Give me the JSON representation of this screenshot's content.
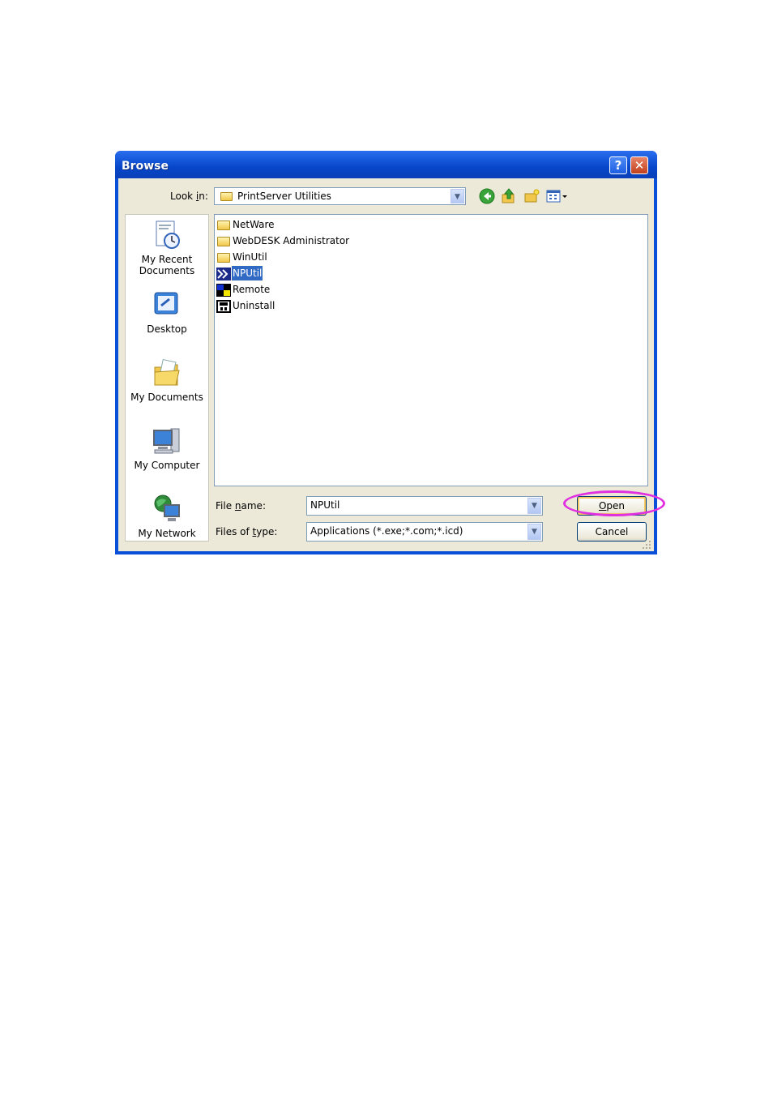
{
  "window": {
    "title": "Browse",
    "help_label": "?",
    "close_label": "✕"
  },
  "lookin": {
    "label_pre": "Look ",
    "label_accel": "i",
    "label_post": "n:",
    "value": "PrintServer Utilities"
  },
  "places": [
    {
      "label_line1": "My Recent",
      "label_line2": "Documents",
      "icon": "recent-documents-icon"
    },
    {
      "label_line1": "Desktop",
      "label_line2": "",
      "icon": "desktop-icon"
    },
    {
      "label_line1": "My Documents",
      "label_line2": "",
      "icon": "my-documents-icon"
    },
    {
      "label_line1": "My Computer",
      "label_line2": "",
      "icon": "my-computer-icon"
    },
    {
      "label_line1": "My Network",
      "label_line2": "",
      "icon": "my-network-icon"
    }
  ],
  "files": [
    {
      "name": "NetWare",
      "icon": "folder-icon"
    },
    {
      "name": "WebDESK Administrator",
      "icon": "folder-icon"
    },
    {
      "name": "WinUtil",
      "icon": "folder-icon"
    },
    {
      "name": "NPUtil",
      "icon": "npunil-app-icon",
      "selected": true
    },
    {
      "name": "Remote",
      "icon": "remote-app-icon"
    },
    {
      "name": "Uninstall",
      "icon": "uninstall-app-icon"
    }
  ],
  "filename": {
    "label_pre": "File ",
    "label_accel": "n",
    "label_post": "ame:",
    "value": "NPUtil"
  },
  "filetype": {
    "label_pre": "Files of ",
    "label_accel": "t",
    "label_post": "ype:",
    "value": "Applications (*.exe;*.com;*.icd)"
  },
  "buttons": {
    "open_accel": "O",
    "open_rest": "pen",
    "cancel": "Cancel"
  },
  "colors": {
    "title_bar": "#0a4fd8",
    "dialog_bg": "#ece9d8",
    "selection": "#316ac5",
    "highlight_ring": "#e030e0"
  }
}
